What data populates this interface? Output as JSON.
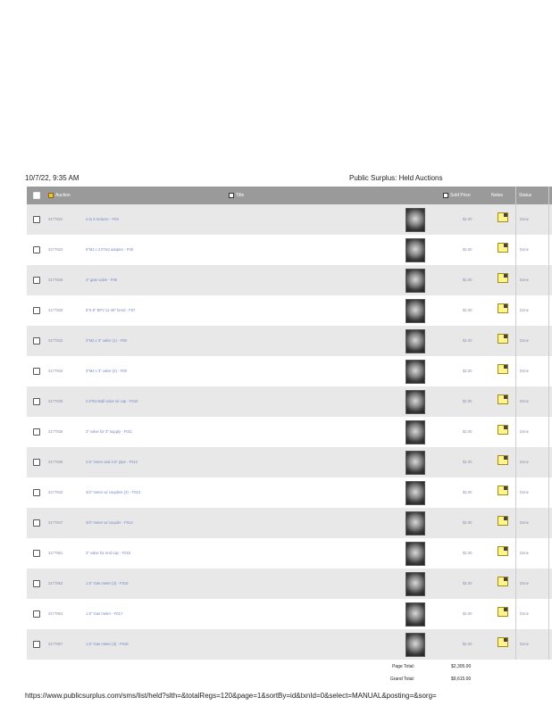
{
  "print_header": {
    "timestamp": "10/7/22, 9:35 AM",
    "title": "Public Surplus: Held Auctions"
  },
  "table": {
    "headers": {
      "auction": "Auction",
      "title": "Title",
      "price": "Sold Price",
      "notes": "Notes",
      "status": "Status"
    },
    "rows": [
      {
        "auction_id": "3177822",
        "title": "4 to 3 reducer - F04",
        "price": "$2.00",
        "status": "Done"
      },
      {
        "auction_id": "3177823",
        "title": "6\"MJ x 2.5\"MJ adapter - F05",
        "price": "$2.00",
        "status": "Done"
      },
      {
        "auction_id": "3177826",
        "title": "4\" gate valve - F06",
        "price": "$2.00",
        "status": "Done"
      },
      {
        "auction_id": "3177828",
        "title": "8\"X 8\" BFV  11-45\" bend - F07",
        "price": "$2.00",
        "status": "Done"
      },
      {
        "auction_id": "3177832",
        "title": "3\"MJ x 3\" valve (1) - F08",
        "price": "$2.00",
        "status": "Done"
      },
      {
        "auction_id": "3177834",
        "title": "3\"MJ x 3\" valve (2) - F09",
        "price": "$2.00",
        "status": "Done"
      },
      {
        "auction_id": "3177835",
        "title": "2.5\"MJ Ball valve  w/ cap - F010",
        "price": "$2.00",
        "status": "Done"
      },
      {
        "auction_id": "3177836",
        "title": "3\" valve for 3\" supply - F011",
        "price": "$2.00",
        "status": "Done"
      },
      {
        "auction_id": "3177838",
        "title": "2.5\" meter and 2.5\" pipe - F012",
        "price": "$2.00",
        "status": "Done"
      },
      {
        "auction_id": "3177842",
        "title": "3/4\" meter w/ couplers (2) - F013",
        "price": "$2.00",
        "status": "Done"
      },
      {
        "auction_id": "3177847",
        "title": "3/4\" meter w/ coupler - F014",
        "price": "$2.00",
        "status": "Done"
      },
      {
        "auction_id": "3177851",
        "title": "3\" valve for end cap - F015",
        "price": "$2.00",
        "status": "Done"
      },
      {
        "auction_id": "3177852",
        "title": "1.5\" Gas meter (2) - F016",
        "price": "$2.00",
        "status": "Done"
      },
      {
        "auction_id": "3177854",
        "title": "1.5\" Gas meter - F017",
        "price": "$2.00",
        "status": "Done"
      },
      {
        "auction_id": "3177857",
        "title": "1.5\" Gas meter (3) - F018",
        "price": "$2.00",
        "status": "Done"
      }
    ]
  },
  "totals": {
    "page_label": "Page Total:",
    "page_value": "$2,305.00",
    "grand_label": "Grand Total:",
    "grand_value": "$9,615.00"
  },
  "footer": {
    "url": "https://www.publicsurplus.com/sms/list/held?slth=&totalRegs=120&page=1&sortBy=id&txnId=0&select=MANUAL&posting=&sorg="
  }
}
